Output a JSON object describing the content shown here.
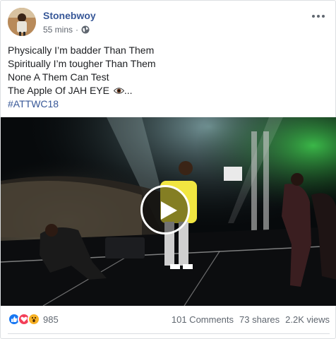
{
  "post": {
    "author": "Stonebwoy",
    "time": "55 mins",
    "separator": "·",
    "lines": [
      "Physically I’m badder Than Them",
      "Spiritually I’m tougher Than Them",
      "None A Them Can Test",
      "The Apple Of JAH EYE"
    ],
    "ellipsis": "...",
    "hashtag": "#ATTWC18"
  },
  "footer": {
    "reaction_count": "985",
    "comments": "101 Comments",
    "shares": "73 shares",
    "views": "2.2K views"
  },
  "icons": {
    "privacy": "globe-icon",
    "menu": "more-options-icon",
    "reactions": [
      "like-icon",
      "love-icon",
      "wow-icon"
    ],
    "video": "play-icon",
    "emoji": "eye-emoji"
  },
  "colors": {
    "link": "#385898",
    "like": "#1877f2",
    "love": "#f33e58",
    "wow": "#f7b125"
  }
}
